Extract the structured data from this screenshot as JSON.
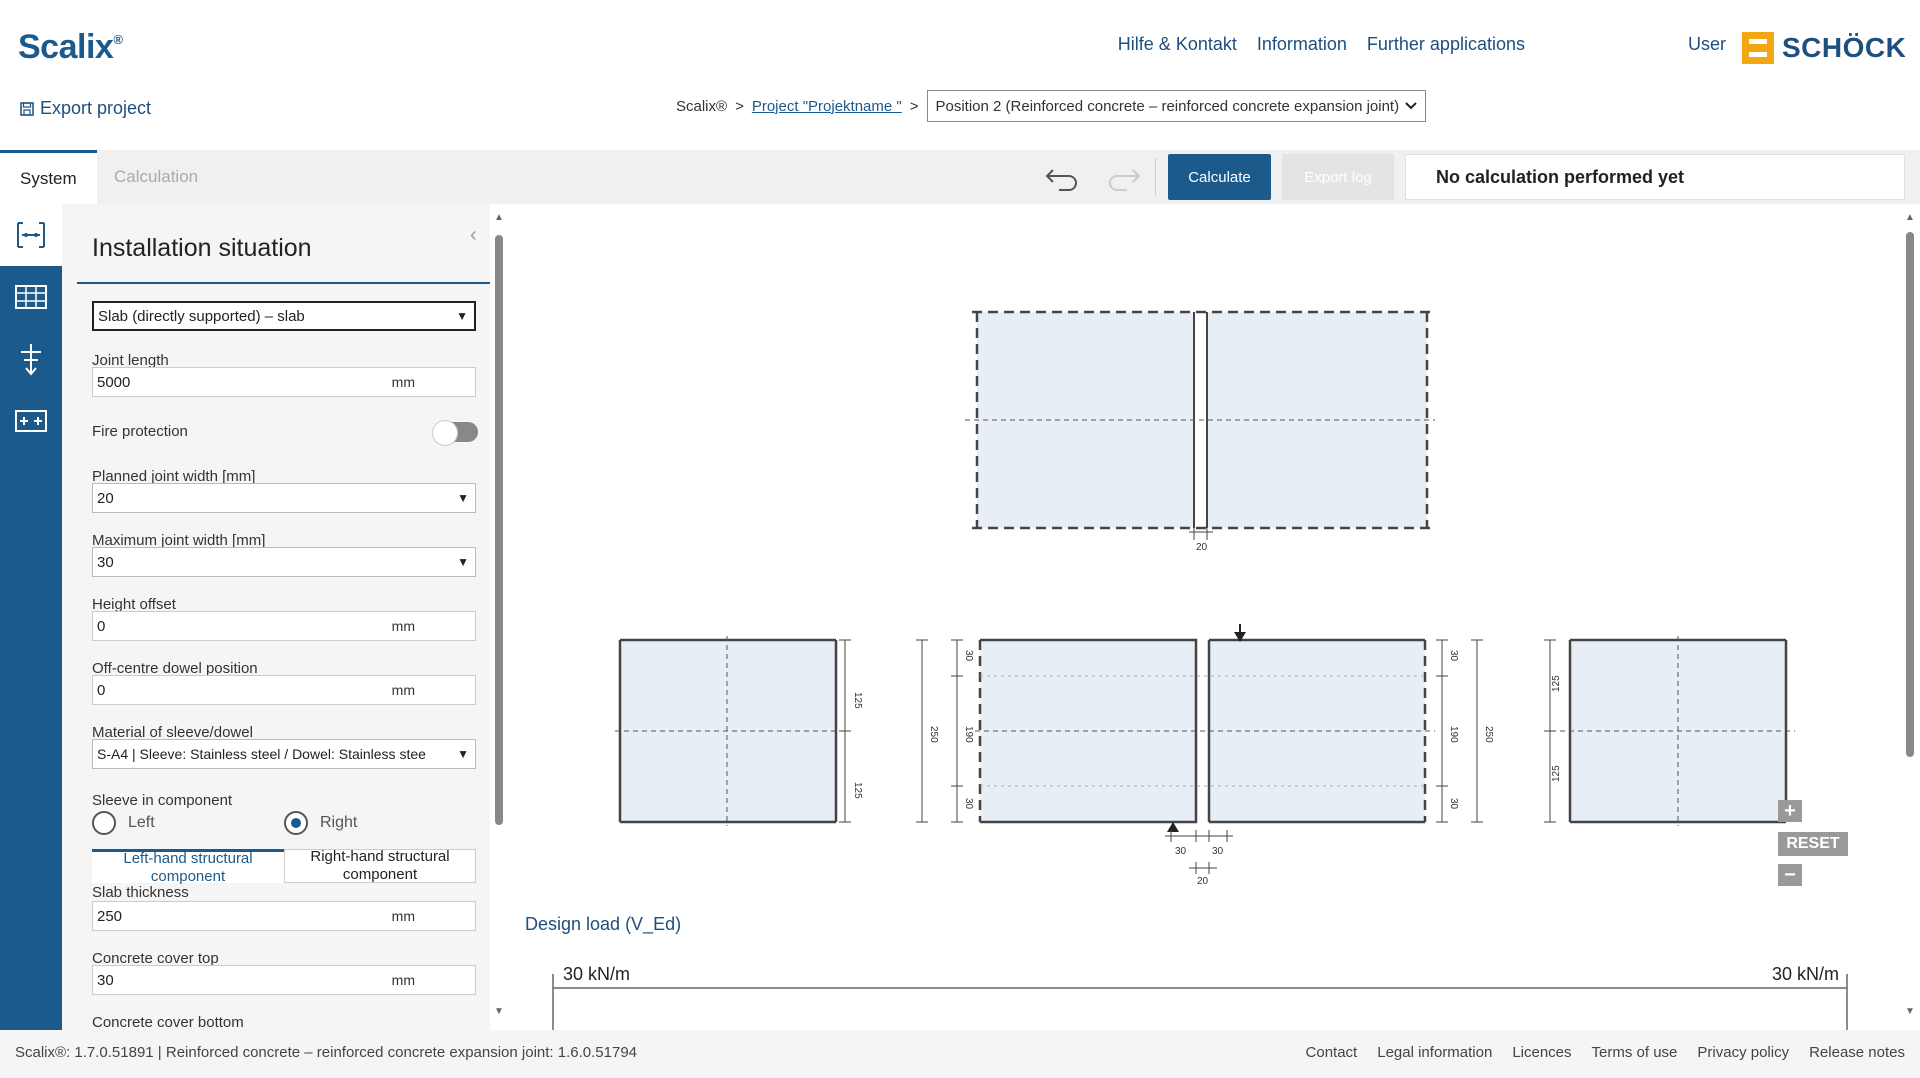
{
  "header": {
    "logo": "Scalix",
    "logo_mark": "®",
    "nav": [
      "Hilfe & Kontakt",
      "Information",
      "Further applications"
    ],
    "user": "User",
    "brand": "SCHÖCK",
    "export_project": "Export project"
  },
  "breadcrumb": {
    "root": "Scalix®",
    "sep": ">",
    "project": "Project \"Projektname \"",
    "position": "Position 2 (Reinforced concrete – reinforced concrete expansion joint)"
  },
  "toolbar": {
    "tab_system": "System",
    "tab_calculation": "Calculation",
    "calculate": "Calculate",
    "export_log": "Export log",
    "status": "No calculation performed yet"
  },
  "sidebar_icons": [
    "joint-icon",
    "slab-grid-icon",
    "dowel-icon",
    "add-icon"
  ],
  "panel": {
    "title": "Installation situation",
    "situation": "Slab (directly supported) – slab",
    "joint_length_label": "Joint length",
    "joint_length": "5000",
    "unit_mm": "mm",
    "fire_label": "Fire protection",
    "planned_width_label": "Planned joint width [mm]",
    "planned_width": "20",
    "max_width_label": "Maximum joint width [mm]",
    "max_width": "30",
    "height_offset_label": "Height offset",
    "height_offset": "0",
    "offcentre_label": "Off-centre dowel position",
    "offcentre": "0",
    "material_label": "Material of sleeve/dowel",
    "material": "S-A4 | Sleeve: Stainless steel / Dowel: Stainless stee",
    "sleeve_label": "Sleeve in component",
    "sleeve_left": "Left",
    "sleeve_right": "Right",
    "sleeve_selected": "Right",
    "subtab_left": "Left-hand structural component",
    "subtab_right": "Right-hand structural component",
    "slab_thickness_label": "Slab thickness",
    "slab_thickness": "250",
    "cover_top_label": "Concrete cover top",
    "cover_top": "30",
    "cover_bottom_label": "Concrete cover bottom"
  },
  "drawing": {
    "dim_joint": "20",
    "dim_125": "125",
    "dim_250": "250",
    "dim_190": "190",
    "dim_30": "30",
    "reset": "RESET",
    "zoom_in": "+",
    "zoom_out": "−"
  },
  "design_load": {
    "title": "Design load (V_Ed)",
    "left": "30 kN/m",
    "right": "30 kN/m"
  },
  "footer": {
    "version": "Scalix®: 1.7.0.51891 | Reinforced concrete – reinforced concrete expansion joint: 1.6.0.51794",
    "links": [
      "Contact",
      "Legal information",
      "Licences",
      "Terms of use",
      "Privacy policy",
      "Release notes"
    ]
  },
  "colors": {
    "brand_blue": "#1d5a8c",
    "brand_orange": "#f3a712",
    "slab_fill": "#e8eef6"
  }
}
